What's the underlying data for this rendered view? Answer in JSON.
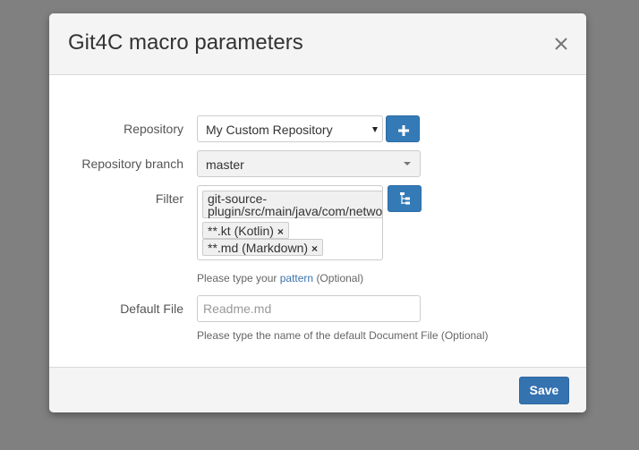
{
  "dialog": {
    "title": "Git4C macro parameters",
    "close_icon": "close-icon"
  },
  "form": {
    "repository": {
      "label": "Repository",
      "selected": "My Custom Repository",
      "add_icon": "plus-icon"
    },
    "branch": {
      "label": "Repository branch",
      "selected": "master"
    },
    "filter": {
      "label": "Filter",
      "tags": [
        {
          "line1": "git-source-",
          "line2": "plugin/src/main/java/com/netwo"
        },
        {
          "text": "**.kt (Kotlin)"
        },
        {
          "text": "**.md (Markdown)"
        }
      ],
      "tag_remove_glyph": "×",
      "tree_icon": "file-tree-icon",
      "help_prefix": "Please type your",
      "help_link": "pattern",
      "help_suffix": "(Optional)"
    },
    "default_file": {
      "label": "Default File",
      "value": "",
      "placeholder": "Readme.md",
      "help": "Please type the name of the default Document File (Optional)"
    }
  },
  "footer": {
    "save_label": "Save"
  },
  "colors": {
    "overlay": "#808080",
    "primary": "#337ab7",
    "link": "#3b73af"
  }
}
